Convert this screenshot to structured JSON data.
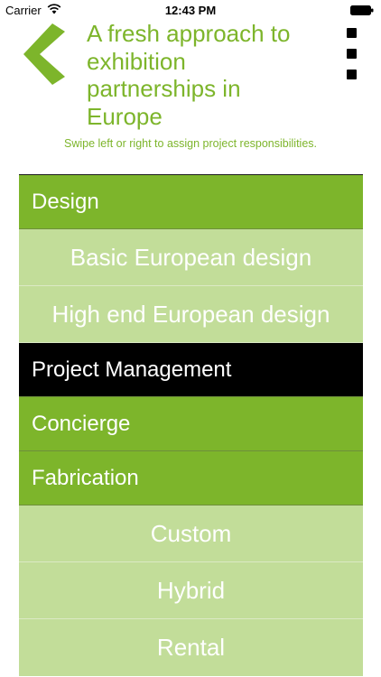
{
  "status_bar": {
    "carrier": "Carrier",
    "time": "12:43 PM",
    "wifi_icon": "wifi-icon",
    "battery_icon": "battery-icon"
  },
  "header": {
    "back_icon": "chevron-left-icon",
    "title": "A fresh approach to exhibition partnerships in Europe",
    "menu_icon": "more-vertical-icon",
    "subtitle": "Swipe left or right to assign project responsibilities."
  },
  "colors": {
    "accent": "#7db52b",
    "sub_item_bg": "#c2dd99",
    "selected_bg": "#000000"
  },
  "list": {
    "items": [
      {
        "label": "Design",
        "kind": "category"
      },
      {
        "label": "Basic European design",
        "kind": "sub"
      },
      {
        "label": "High end European design",
        "kind": "sub"
      },
      {
        "label": "Project Management",
        "kind": "selected"
      },
      {
        "label": "Concierge",
        "kind": "category"
      },
      {
        "label": "Fabrication",
        "kind": "category"
      },
      {
        "label": "Custom",
        "kind": "sub"
      },
      {
        "label": "Hybrid",
        "kind": "sub"
      },
      {
        "label": "Rental",
        "kind": "sub"
      }
    ]
  }
}
